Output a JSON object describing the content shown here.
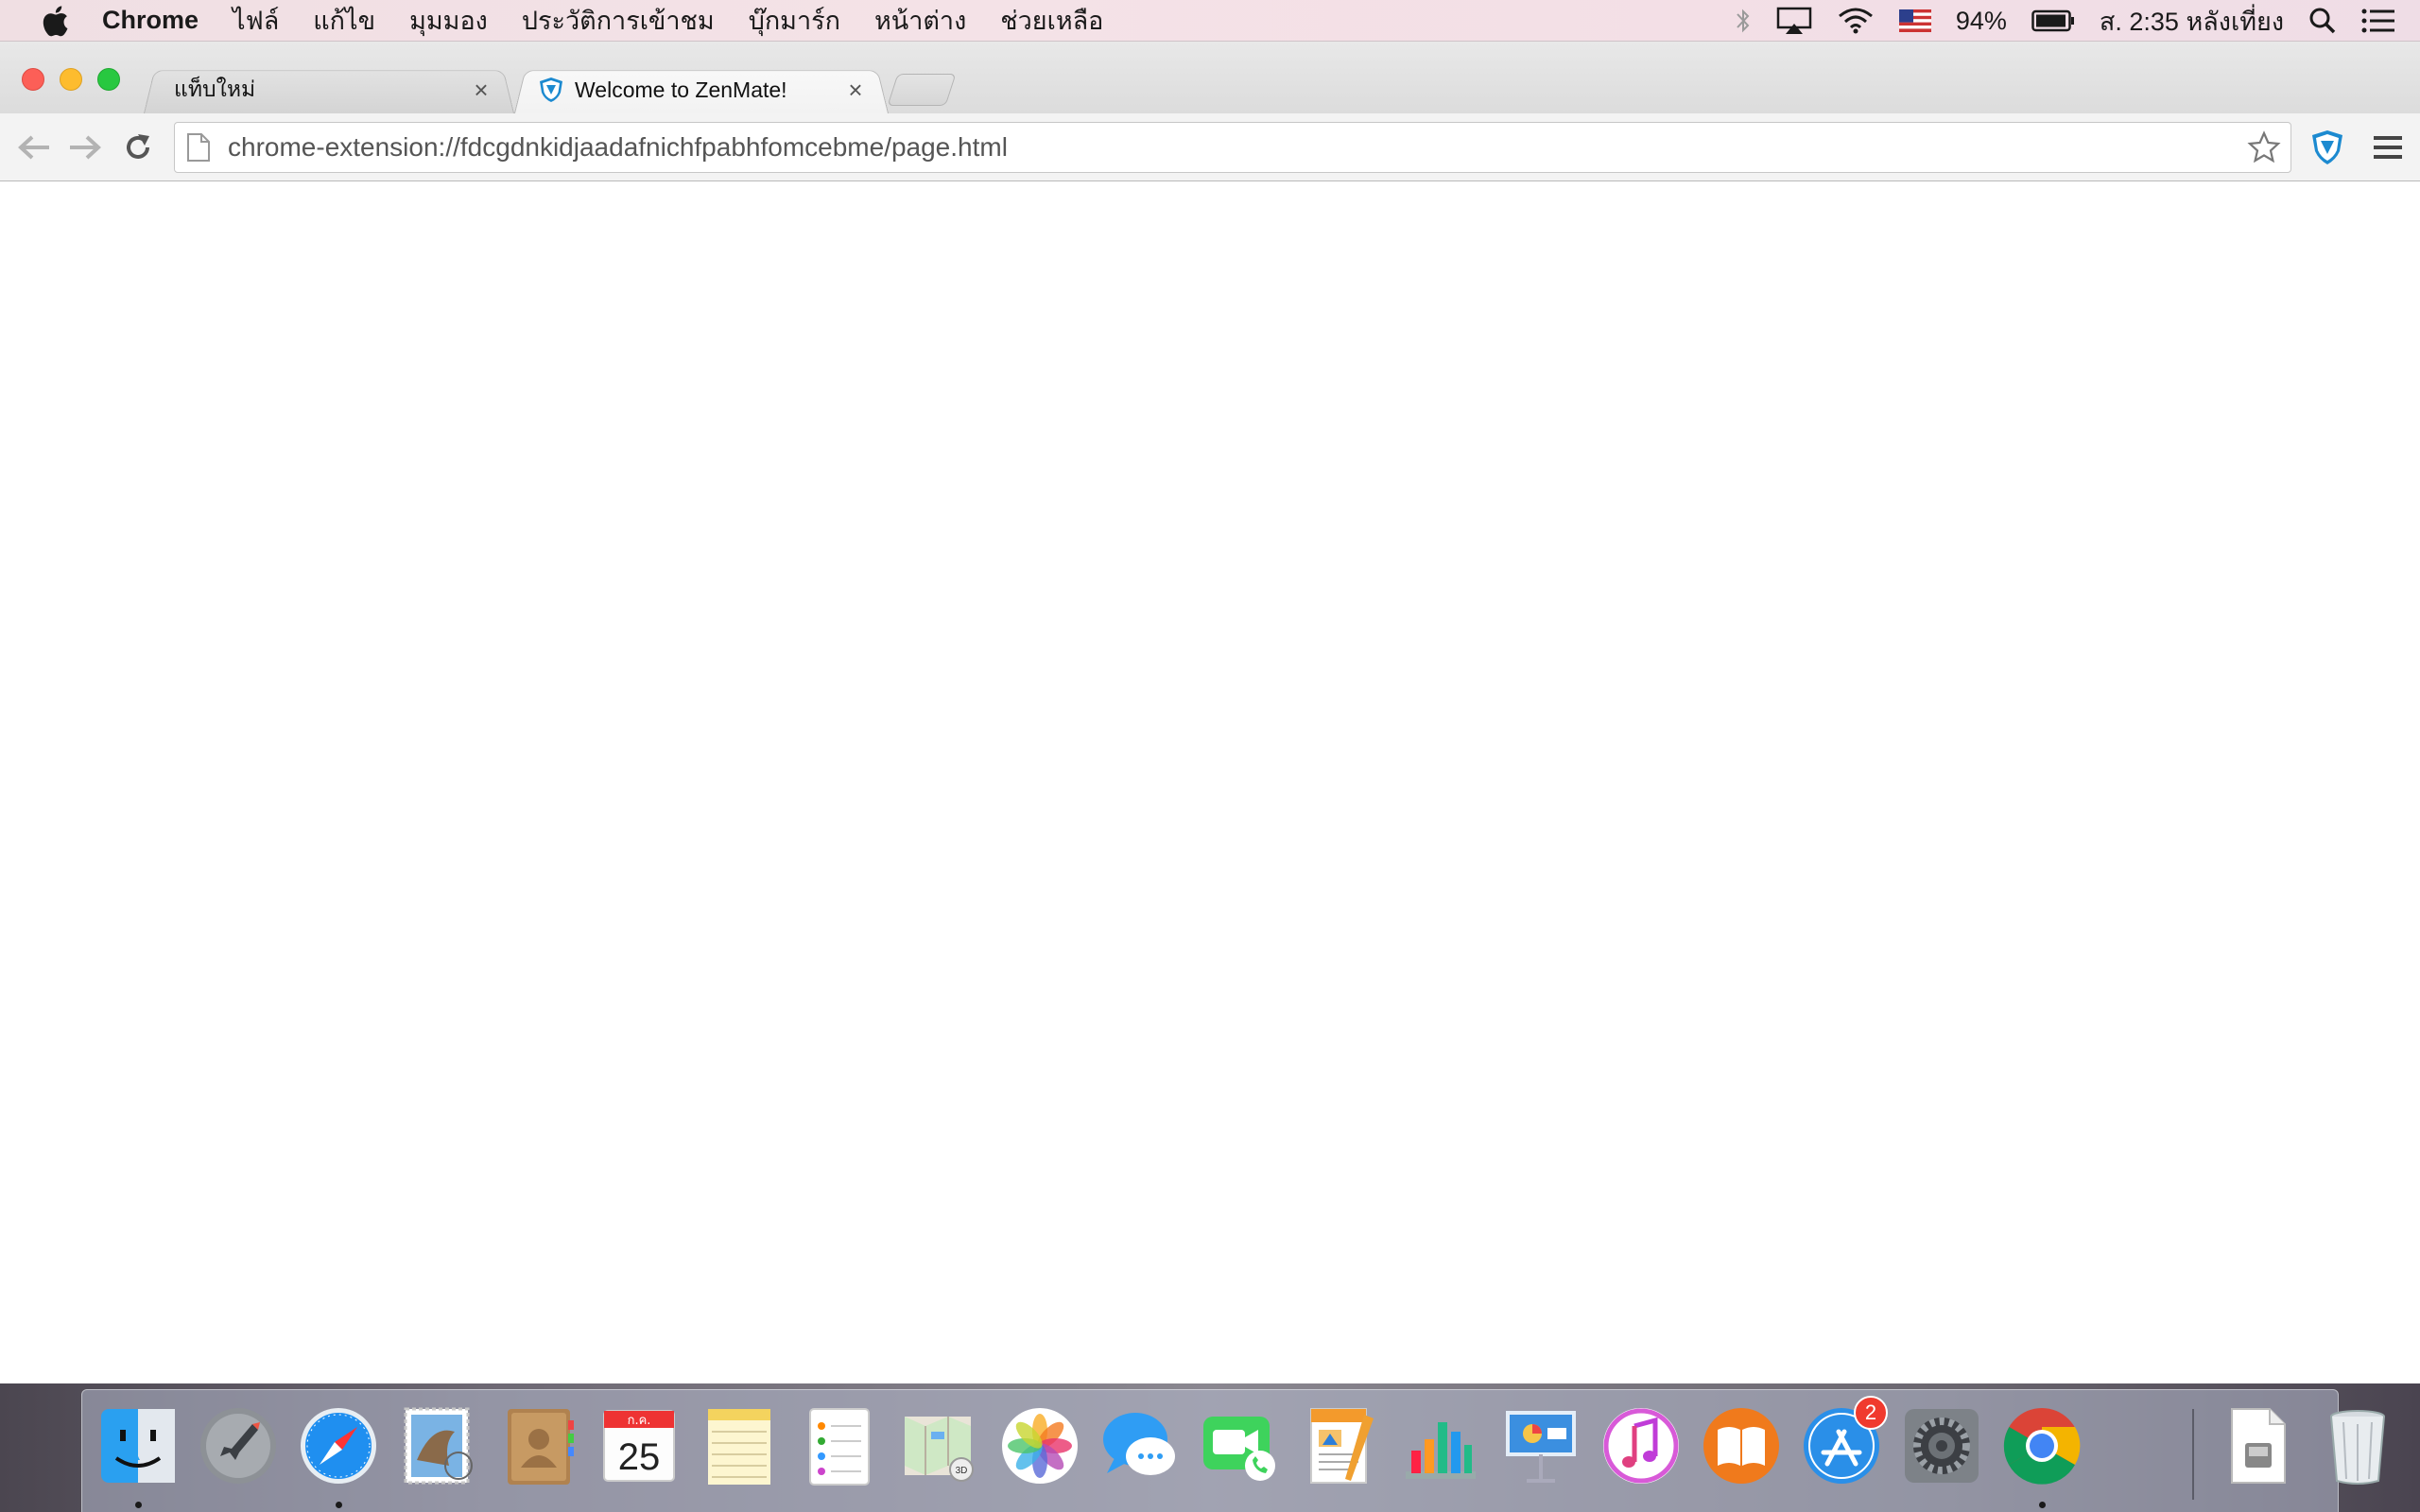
{
  "menubar": {
    "app_name": "Chrome",
    "items": [
      "ไฟล์",
      "แก้ไข",
      "มุมมอง",
      "ประวัติการเข้าชม",
      "บุ๊กมาร์ก",
      "หน้าต่าง",
      "ช่วยเหลือ"
    ],
    "battery_percent": "94%",
    "clock": "ส. 2:35 หลังเที่ยง"
  },
  "tabs": [
    {
      "title": "แท็บใหม่",
      "active": false
    },
    {
      "title": "Welcome to ZenMate!",
      "active": true
    }
  ],
  "toolbar": {
    "url": "chrome-extension://fdcgdnkidjaadafnichfpabhfomcebme/page.html"
  },
  "dock": {
    "calendar_month": "ก.ค.",
    "calendar_day": "25",
    "app_store_badge": "2",
    "items": [
      "finder",
      "launchpad",
      "safari",
      "mail",
      "contacts",
      "calendar",
      "notes",
      "reminders",
      "maps",
      "photos",
      "messages",
      "facetime",
      "pages",
      "numbers",
      "keynote",
      "itunes",
      "ibooks",
      "app-store",
      "system-preferences",
      "chrome",
      "downloads-document",
      "trash"
    ]
  }
}
